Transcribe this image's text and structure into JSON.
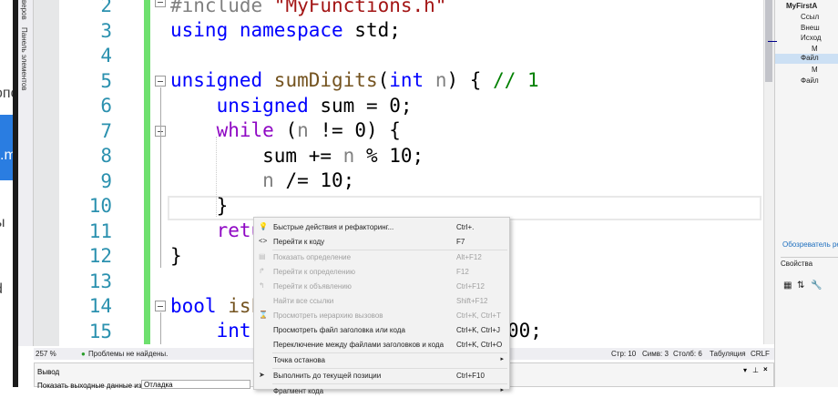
{
  "left_app": {
    "fragments": [
      "опо",
      ".m",
      "ы",
      "d"
    ]
  },
  "vertical_tabs": [
    "веров",
    "Панель элементов"
  ],
  "editor": {
    "line_numbers": [
      "2",
      "3",
      "4",
      "5",
      "6",
      "7",
      "8",
      "9",
      "10",
      "11",
      "12",
      "13",
      "14",
      "15"
    ],
    "lines": {
      "l2": {
        "a": "#include ",
        "b": "\"MyFunctions.h\""
      },
      "l3": {
        "a": "using namespace ",
        "b": "std;"
      },
      "l5": {
        "a": "unsigned ",
        "b": "sumDigits",
        "c": "(",
        "d": "int ",
        "e": "n",
        ":": "",
        "f": ") { ",
        "g": "// 1"
      },
      "l6": {
        "a": "    unsigned ",
        "b": "sum = 0;"
      },
      "l7": {
        "a": "    while ",
        "b": "(",
        "c": "n",
        "d": " != 0) {"
      },
      "l8": {
        "a": "        sum += ",
        "b": "n",
        "c": " % 10;"
      },
      "l9": {
        "a": "        ",
        "b": "n",
        "c": " /= 10;"
      },
      "l10": "    }",
      "l11": "    retu",
      "l12": "}",
      "l14": {
        "a": "bool ",
        "b": "isL"
      },
      "l15": {
        "a": "    int",
        "b": "00;"
      }
    }
  },
  "status": {
    "zoom": "257 %",
    "problems": "Проблемы не найдены.",
    "line": "Стр: 10",
    "char": "Симв: 3",
    "col": "Столб: 6",
    "tabs": "Табуляция",
    "eol": "CRLF"
  },
  "output": {
    "title": "Вывод",
    "show_label": "Показать выходные данные из:",
    "source": "Отладка"
  },
  "solution": {
    "items": [
      "MyFirstA",
      "Ссыл",
      "Внеш",
      "Исход",
      "М",
      "Файл",
      "М",
      "Файл"
    ],
    "explorer_link": "Обозреватель ре",
    "properties": "Свойства"
  },
  "context_menu": [
    {
      "label": "Быстрые действия и рефакторинг...",
      "shortcut": "Ctrl+.",
      "icon": "lightbulb-icon",
      "disabled": false
    },
    {
      "label": "Перейти к коду",
      "shortcut": "F7",
      "icon": "code-icon",
      "disabled": false
    },
    {
      "label": "Показать определение",
      "shortcut": "Alt+F12",
      "icon": "peek-icon",
      "disabled": true
    },
    {
      "label": "Перейти к определению",
      "shortcut": "F12",
      "icon": "goto-definition-icon",
      "disabled": true
    },
    {
      "label": "Перейти к объявлению",
      "shortcut": "Ctrl+F12",
      "icon": "goto-declaration-icon",
      "disabled": true
    },
    {
      "label": "Найти все ссылки",
      "shortcut": "Shift+F12",
      "icon": "",
      "disabled": true
    },
    {
      "label": "Просмотреть иерархию вызовов",
      "shortcut": "Ctrl+K, Ctrl+T",
      "icon": "call-hierarchy-icon",
      "disabled": true
    },
    {
      "label": "Просмотреть файл заголовка или кода",
      "shortcut": "Ctrl+K, Ctrl+J",
      "icon": "",
      "disabled": false
    },
    {
      "label": "Переключение между файлами заголовков и кода",
      "shortcut": "Ctrl+K, Ctrl+O",
      "icon": "",
      "disabled": false
    },
    {
      "label": "Точка останова",
      "shortcut": "",
      "icon": "",
      "disabled": false,
      "submenu": true
    },
    {
      "label": "Выполнить до текущей позиции",
      "shortcut": "Ctrl+F10",
      "icon": "run-to-cursor-icon",
      "disabled": false
    },
    {
      "label": "Фрагмент кода",
      "shortcut": "",
      "icon": "",
      "disabled": false,
      "submenu": true
    }
  ]
}
